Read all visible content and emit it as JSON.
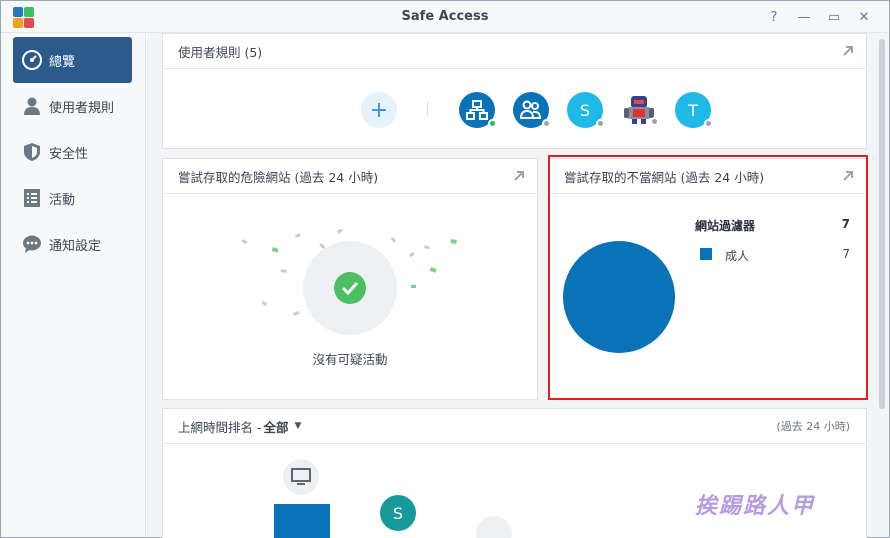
{
  "window": {
    "title": "Safe Access",
    "controls": [
      "?",
      "—",
      "▭",
      "✕"
    ]
  },
  "sidebar": {
    "items": [
      {
        "label": "總覽",
        "icon": "dashboard-gauge-icon",
        "active": true
      },
      {
        "label": "使用者規則",
        "icon": "user-icon",
        "active": false
      },
      {
        "label": "安全性",
        "icon": "shield-icon",
        "active": false
      },
      {
        "label": "活動",
        "icon": "list-document-icon",
        "active": false
      },
      {
        "label": "通知設定",
        "icon": "chat-bubble-icon",
        "active": false
      }
    ]
  },
  "user_rules": {
    "title": "使用者規則 (5)",
    "add_label": "+",
    "avatars": [
      {
        "icon": "network-device-icon",
        "letter": "",
        "color": "#0a73b7",
        "status": "#3cb54a"
      },
      {
        "icon": "user-group-icon",
        "letter": "",
        "color": "#0a73b7",
        "status": "#9aa4ad"
      },
      {
        "icon": "letter-avatar",
        "letter": "S",
        "color": "#1fb9e8",
        "status": "#9aa4ad"
      },
      {
        "icon": "robot-avatar-icon",
        "letter": "",
        "color": "#ffffff",
        "status": "#9aa4ad"
      },
      {
        "icon": "letter-avatar",
        "letter": "T",
        "color": "#1fb9e8",
        "status": "#9aa4ad"
      }
    ]
  },
  "dangerous_sites": {
    "title": "嘗試存取的危險網站 (過去 24 小時)",
    "empty_text": "沒有可疑活動"
  },
  "improper_sites": {
    "title": "嘗試存取的不當網站 (過去 24 小時)",
    "legend_header": "網站過濾器",
    "legend_total": "7",
    "items": [
      {
        "label": "成人",
        "value": "7",
        "color": "#0a73b7"
      }
    ]
  },
  "ranking": {
    "title_prefix": "上網時間排名 - ",
    "filter_value": "全部",
    "range_label": "(過去 24 小時)",
    "letter_avatar": "S"
  },
  "watermark": "挨踢路人甲",
  "colors": {
    "accent": "#2c5a8c",
    "pie": "#0a73b7",
    "highlight": "#e02020",
    "check": "#4cbf62"
  }
}
